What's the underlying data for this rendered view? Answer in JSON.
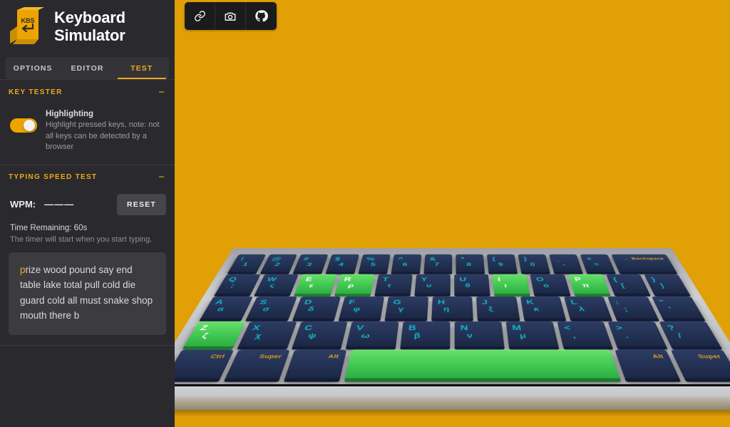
{
  "app": {
    "title_line1": "Keyboard",
    "title_line2": "Simulator",
    "logo_text": "KBS",
    "background_color": "#e0a006",
    "accent_color": "#f0a81e",
    "highlight_key_color": "#3fc650",
    "key_color": "#223052",
    "legend_color": "#11b6c4"
  },
  "tabs": [
    {
      "label": "OPTIONS",
      "active": false
    },
    {
      "label": "EDITOR",
      "active": false
    },
    {
      "label": "TEST",
      "active": true
    }
  ],
  "key_tester": {
    "title": "KEY TESTER",
    "collapse_glyph": "−",
    "toggle": {
      "label": "Highlighting",
      "description": "Highlight pressed keys, note: not all keys can be detected by a browser",
      "on": true
    }
  },
  "typing_speed_test": {
    "title": "TYPING SPEED TEST",
    "collapse_glyph": "−",
    "wpm_label": "WPM:",
    "wpm_value": "———",
    "reset_label": "RESET",
    "time_remaining": "Time Remaining: 60s",
    "timer_hint": "The timer will start when you start typing.",
    "prompt_cursor_char": "p",
    "prompt_rest": "rize wood pound say end table lake total pull cold die guard cold all must snake shop mouth there b"
  },
  "toolbar_icons": [
    {
      "name": "link-icon",
      "title": "Share link"
    },
    {
      "name": "camera-icon",
      "title": "Screenshot"
    },
    {
      "name": "github-icon",
      "title": "GitHub"
    }
  ],
  "keyboard": {
    "rows": [
      [
        {
          "main": "!",
          "sub": "1",
          "w": ""
        },
        {
          "main": "@",
          "sub": "2",
          "w": ""
        },
        {
          "main": "#",
          "sub": "3",
          "w": ""
        },
        {
          "main": "$",
          "sub": "4",
          "w": ""
        },
        {
          "main": "%",
          "sub": "5",
          "w": ""
        },
        {
          "main": "^",
          "sub": "6",
          "w": ""
        },
        {
          "main": "&",
          "sub": "7",
          "w": ""
        },
        {
          "main": "*",
          "sub": "8",
          "w": ""
        },
        {
          "main": "(",
          "sub": "9",
          "w": ""
        },
        {
          "main": ")",
          "sub": "0",
          "w": ""
        },
        {
          "main": "_",
          "sub": "-",
          "w": ""
        },
        {
          "main": "+",
          "sub": "=",
          "w": ""
        },
        {
          "word": "← Backspace",
          "w": "w200"
        }
      ],
      [
        {
          "main": "Q",
          "sub": ";",
          "lit": false
        },
        {
          "main": "W",
          "sub": "ς",
          "lit": false
        },
        {
          "main": "E",
          "sub": "ε",
          "lit": true
        },
        {
          "main": "R",
          "sub": "ρ",
          "lit": true
        },
        {
          "main": "T",
          "sub": "τ",
          "lit": false
        },
        {
          "main": "Y",
          "sub": "υ",
          "lit": false
        },
        {
          "main": "U",
          "sub": "θ",
          "lit": false
        },
        {
          "main": "I",
          "sub": "ι",
          "lit": true
        },
        {
          "main": "O",
          "sub": "ο",
          "lit": false
        },
        {
          "main": "P",
          "sub": "π",
          "lit": true
        },
        {
          "main": "{",
          "sub": "[",
          "lit": false
        },
        {
          "main": "}",
          "sub": "]",
          "lit": false
        }
      ],
      [
        {
          "main": "A",
          "sub": "α",
          "lit": false
        },
        {
          "main": "S",
          "sub": "σ",
          "lit": false
        },
        {
          "main": "D",
          "sub": "δ",
          "lit": false
        },
        {
          "main": "F",
          "sub": "φ",
          "lit": false
        },
        {
          "main": "G",
          "sub": "γ",
          "lit": false
        },
        {
          "main": "H",
          "sub": "η",
          "lit": false
        },
        {
          "main": "J",
          "sub": "ξ",
          "lit": false
        },
        {
          "main": "K",
          "sub": "κ",
          "lit": false
        },
        {
          "main": "L",
          "sub": "λ",
          "lit": false
        },
        {
          "main": ":",
          "sub": ";",
          "lit": false
        },
        {
          "main": "\"",
          "sub": "'",
          "lit": false
        }
      ],
      [
        {
          "main": "Z",
          "sub": "ζ",
          "lit": true
        },
        {
          "main": "X",
          "sub": "χ",
          "lit": false
        },
        {
          "main": "C",
          "sub": "ψ",
          "lit": false
        },
        {
          "main": "V",
          "sub": "ω",
          "lit": false
        },
        {
          "main": "B",
          "sub": "β",
          "lit": false
        },
        {
          "main": "N",
          "sub": "ν",
          "lit": false
        },
        {
          "main": "M",
          "sub": "μ",
          "lit": false
        },
        {
          "main": "<",
          "sub": ",",
          "lit": false
        },
        {
          "main": ">",
          "sub": ".",
          "lit": false
        },
        {
          "main": "?",
          "sub": "/",
          "lit": false
        }
      ],
      [
        {
          "word": "Ctrl",
          "w": "w125",
          "lit": false
        },
        {
          "word": "Super",
          "w": "w125",
          "lit": false
        },
        {
          "word": "Alt",
          "w": "w125",
          "lit": false
        },
        {
          "word": "",
          "w": "w625",
          "lit": true
        },
        {
          "word": "Alt",
          "w": "w125",
          "lit": false
        },
        {
          "word": "Super",
          "w": "w125",
          "lit": false
        }
      ]
    ]
  }
}
